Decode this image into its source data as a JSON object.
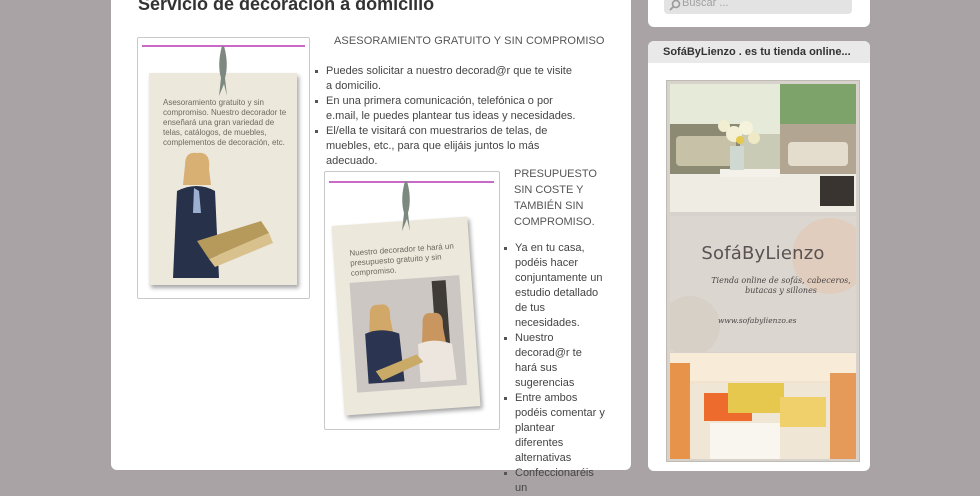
{
  "page_title": "Servicio de decoración a domicilio",
  "left_card": {
    "caption": "Asesoramiento gratuito y sin compromiso. Nuestro decorador te enseñará una gran variedad de telas, catálogos, de muebles, complementos de decoración, etc."
  },
  "right_card": {
    "caption": "Nuestro decorador te hará un presupuesto gratuito y sin compromiso."
  },
  "section1": {
    "heading": "ASESORAMIENTO GRATUITO Y  SIN COMPROMISO",
    "items": [
      "Puedes solicitar a nuestro decorad@r que  te visite a domicilio.",
      "En una primera comunicación, telefónica o por e.mail, le puedes plantear tus ideas y necesidades.",
      "El/ella te visitará con muestrarios de telas, de muebles, etc., para que elijáis juntos lo más adecuado."
    ]
  },
  "section2": {
    "heading": "PRESUPUESTO SIN  COSTE Y  TAMBIÉN  SIN COMPROMISO.",
    "items": [
      "Ya en tu casa, podéis hacer conjuntamente un estudio detallado de tus necesidades.",
      "Nuestro decorad@r te hará sus sugerencias",
      "Entre ambos podéis comentar y plantear diferentes alternativas",
      "Confeccionaréis un"
    ]
  },
  "search": {
    "placeholder": "Buscar ..."
  },
  "sidebar_widget": {
    "title": "SofáByLienzo . es tu tienda online...",
    "banner": {
      "brand": "SofáByLienzo",
      "tagline": "Tienda online de sofás, cabeceros, butacas y sillones",
      "url": "www.sofabylienzo.es"
    }
  },
  "colors": {
    "background": "#a9a3a5",
    "accent_line": "#c96ac8",
    "text": "#444444"
  }
}
